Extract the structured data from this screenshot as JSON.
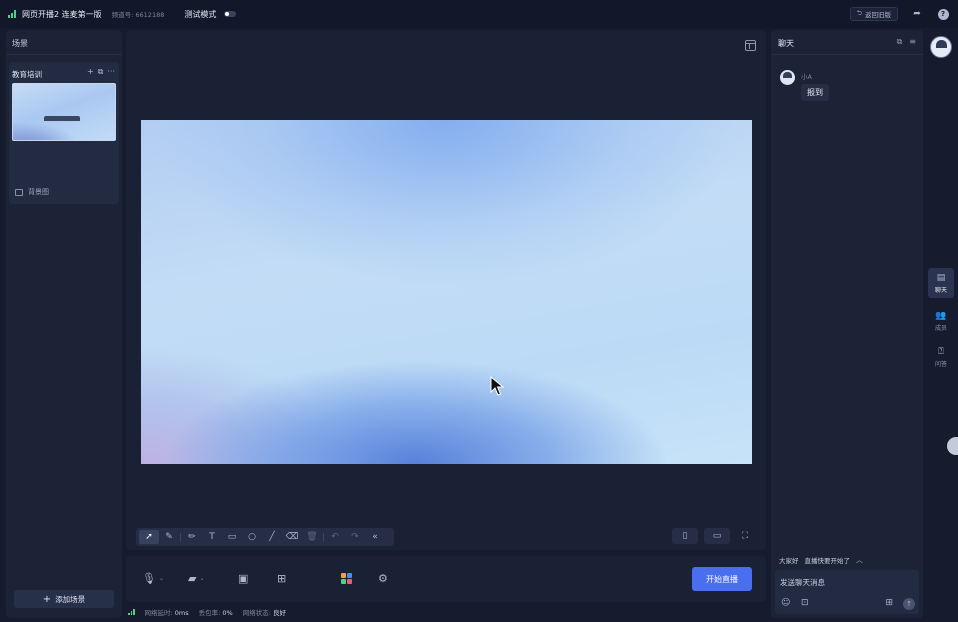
{
  "topbar": {
    "title": "网页开播2 连麦第一版",
    "channel": "频道号: 6612188",
    "mode_label": "测试模式",
    "return_label": "返回旧版"
  },
  "left_panel": {
    "title": "场景",
    "scene_name": "教育培训",
    "background_label": "背景图",
    "add_scene_label": "添加场景"
  },
  "status_bar": {
    "latency_label": "网络延时:",
    "latency_value": "0ms",
    "loss_label": "丢包率:",
    "loss_value": "0%",
    "state_label": "网络状态:",
    "state_value": "良好"
  },
  "controls": {
    "start_label": "开始直播"
  },
  "chat": {
    "title": "聊天",
    "messages": [
      {
        "user": "小A",
        "text": "报到"
      }
    ],
    "quick_replies": [
      "大家好",
      "直播快要开始了"
    ],
    "input_placeholder": "发送聊天消息"
  },
  "rail": {
    "items": [
      {
        "label": "聊天",
        "icon": "chat-icon"
      },
      {
        "label": "成员",
        "icon": "members-icon"
      },
      {
        "label": "问答",
        "icon": "qa-icon"
      }
    ]
  },
  "colors": {
    "accent": "#4a6ef0",
    "signal": "#4fd18b",
    "background": "#161c2e",
    "panel": "#1c2336"
  }
}
